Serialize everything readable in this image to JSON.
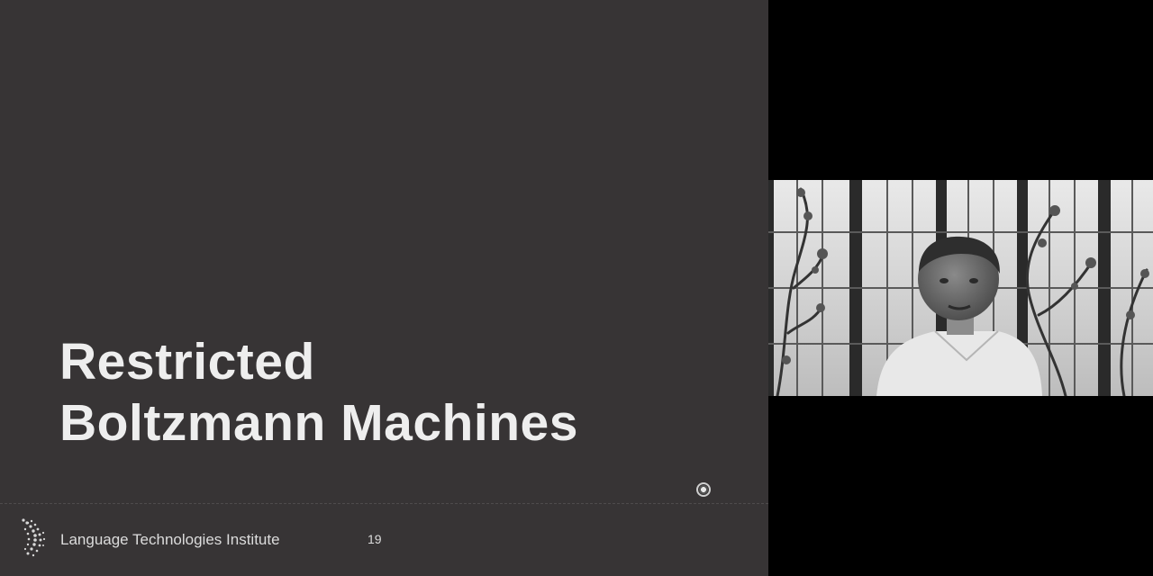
{
  "slide": {
    "title_line1": "Restricted",
    "title_line2": "Boltzmann Machines",
    "footer_institute": "Language Technologies Institute",
    "page_number": "19"
  },
  "webcam": {
    "description_icon": "presenter-video-icon"
  },
  "colors": {
    "slide_background": "#373435",
    "title_text": "#eeeeee",
    "screen_background": "#000000"
  }
}
